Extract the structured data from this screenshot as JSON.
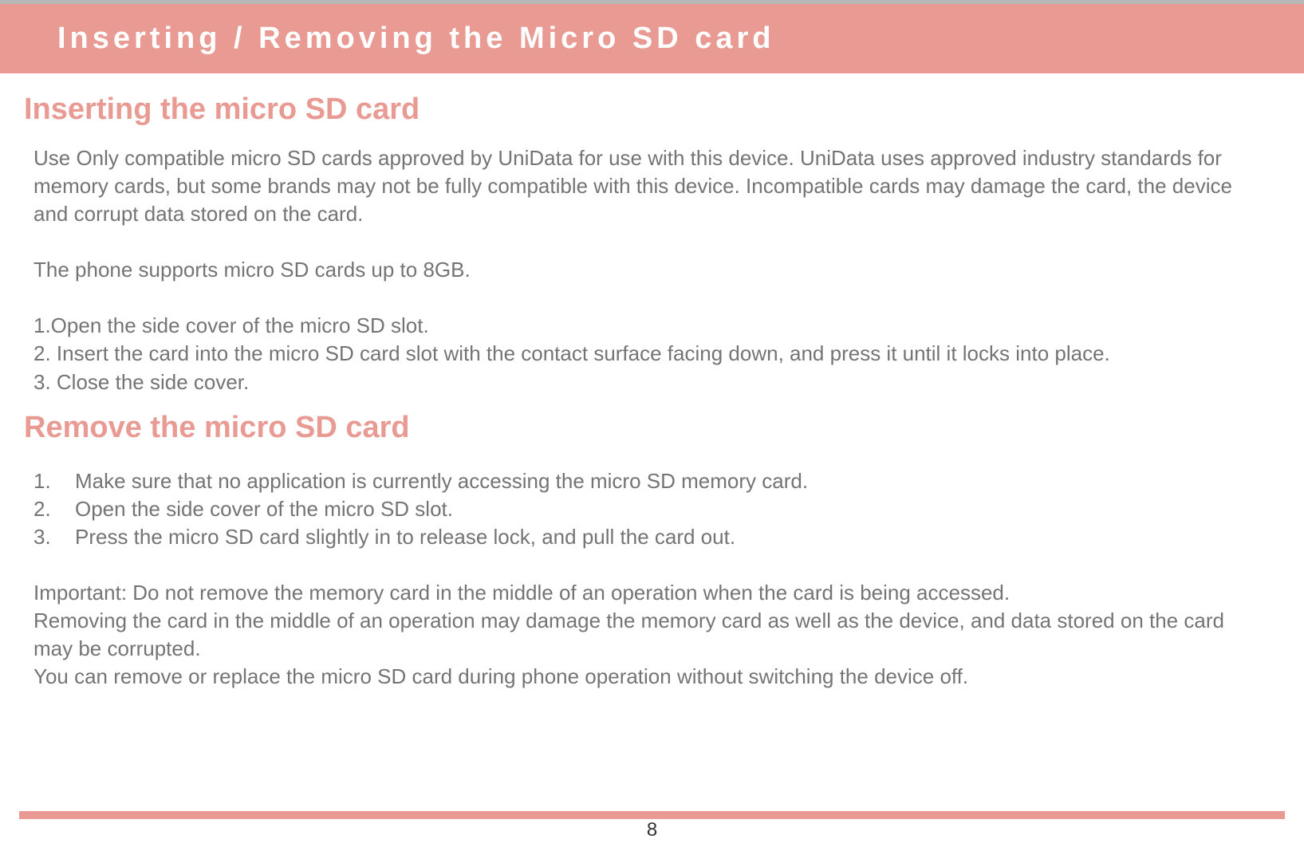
{
  "header": {
    "title": "Inserting / Removing the Micro SD card"
  },
  "section1": {
    "heading": "Inserting the micro SD card",
    "para1": "Use Only compatible micro SD cards approved by UniData for use with this device. UniData uses approved industry standards for memory cards, but some brands may not be fully compatible with this device. Incompatible cards may damage the card, the device and corrupt data stored on the card.",
    "para2": "The phone supports micro SD cards up to 8GB.",
    "step1": "1.Open the side cover of the micro SD slot.",
    "step2": "2. Insert the card into the micro SD card slot with the contact surface facing down, and press it until it locks into place.",
    "step3": "3. Close the side cover."
  },
  "section2": {
    "heading": "Remove the micro SD card",
    "steps": [
      {
        "num": "1.",
        "text": "Make sure that no application is currently accessing the micro SD memory card."
      },
      {
        "num": "2.",
        "text": "Open the side cover of the micro SD slot."
      },
      {
        "num": "3.",
        "text": "Press the micro SD card slightly in to release lock, and pull the card out."
      }
    ],
    "note1": "Important: Do not remove the memory card in the middle of an operation when the card is being accessed.",
    "note2": "Removing the card in the middle of an operation may damage the memory card as well as the device, and data stored on the card may be corrupted.",
    "note3": "You can remove or replace the micro SD card during phone operation without switching the device off."
  },
  "pageNumber": "8"
}
